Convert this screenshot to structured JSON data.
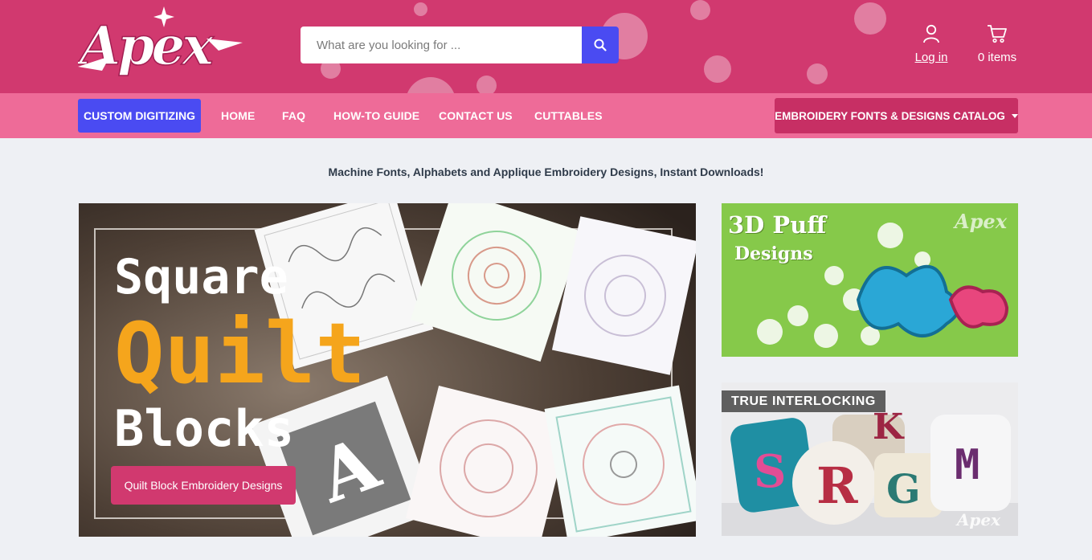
{
  "brand": {
    "logo_text": "Apex"
  },
  "search": {
    "placeholder": "What are you looking for ...",
    "icon": "search-icon"
  },
  "account": {
    "label": "Log in",
    "icon": "user-icon"
  },
  "cart": {
    "label": "0 items",
    "icon": "cart-icon"
  },
  "nav": {
    "custom_digitizing": "CUSTOM DIGITIZING",
    "items": [
      "HOME",
      "FAQ",
      "HOW-TO GUIDE",
      "CONTACT US",
      "CUTTABLES"
    ],
    "catalog": "EMBROIDERY FONTS & DESIGNS CATALOG"
  },
  "tagline": "Machine Fonts, Alphabets and Applique Embroidery Designs, Instant Downloads!",
  "hero": {
    "title_line1": "Square",
    "title_line2": "Quilt",
    "title_line3": "Blocks",
    "button_label": "Quilt Block Embroidery Designs"
  },
  "banner_puff": {
    "title": "3D Puff",
    "subtitle": "Designs",
    "watermark": "Apex"
  },
  "banner_interlocking": {
    "label": "TRUE INTERLOCKING",
    "watermark": "Apex"
  },
  "colors": {
    "header": "#d1396f",
    "nav": "#ee6b98",
    "accent_blue": "#4a4bf2",
    "catalog_btn": "#c72f64",
    "hero_accent": "#f5a51c"
  }
}
